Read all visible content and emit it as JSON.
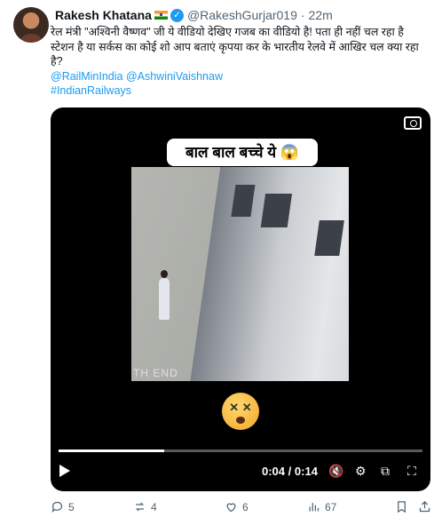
{
  "tweet": {
    "author_name": "Rakesh Khatana",
    "handle": "@RakeshGurjar019",
    "dot": "·",
    "time": "22m",
    "text": "रेल मंत्री \"अश्विनी वैष्णव\" जी ये वीडियो देखिए गजब का वीडियो है! पता ही नहीं चल रहा है स्टेशन है या सर्कस का कोई शो आप बताएं कृपया कर के भारतीय रेलवे में आखिर चल क्या रहा है?",
    "mentions": "@RailMinIndia @AshwiniVaishnaw",
    "hashtag": "#IndianRailways"
  },
  "video": {
    "caption": "बाल बाल बच्चे ये 😱",
    "watermark": "TH END",
    "current_time": "0:04",
    "separator": "/",
    "duration": "0:14",
    "progress": 0.29
  },
  "actions": {
    "replies": "5",
    "reposts": "4",
    "likes": "6",
    "views": "67"
  }
}
